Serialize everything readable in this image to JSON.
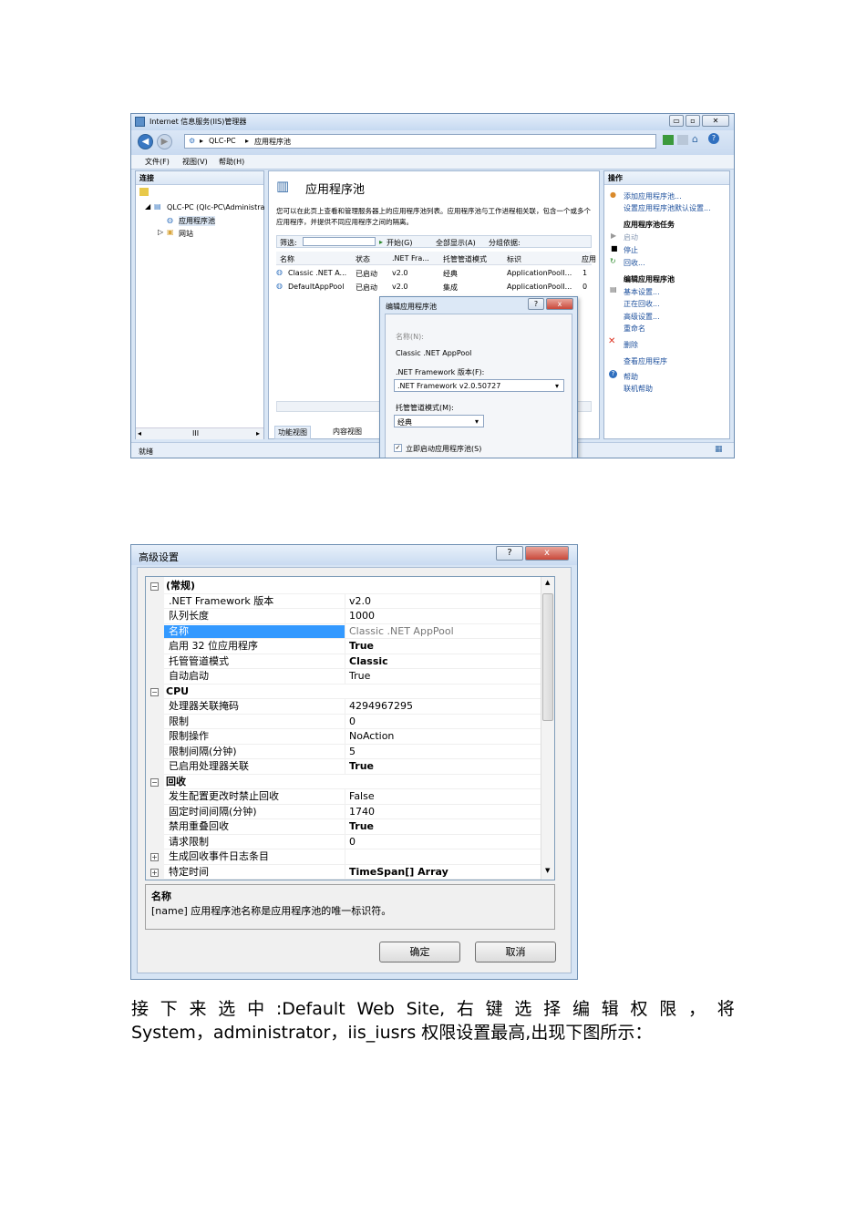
{
  "iis": {
    "title": "Internet 信息服务(IIS)管理器",
    "breadcrumb": [
      "QLC-PC",
      "应用程序池"
    ],
    "menu": [
      "文件(F)",
      "视图(V)",
      "帮助(H)"
    ],
    "connections": {
      "header": "连接",
      "tree": [
        "QLC-PC (Qlc-PC\\Administra",
        "应用程序池",
        "网站"
      ]
    },
    "main": {
      "title": "应用程序池",
      "description": "您可以在此页上查看和管理服务器上的应用程序池列表。应用程序池与工作进程相关联，包含一个或多个应用程序，并提供不同应用程序之间的隔离。",
      "filter_label": "筛选:",
      "start_label": "开始(G)",
      "show_all_label": "全部显示(A)",
      "group_label": "分组依据:",
      "columns": [
        "名称",
        "状态",
        ".NET Fra...",
        "托管管道模式",
        "标识",
        "应用"
      ],
      "rows": [
        [
          "Classic .NET A...",
          "已启动",
          "v2.0",
          "经典",
          "ApplicationPoolI...",
          "1"
        ],
        [
          "DefaultAppPool",
          "已启动",
          "v2.0",
          "集成",
          "ApplicationPoolI...",
          "0"
        ]
      ],
      "tabs": [
        "功能视图",
        "内容视图"
      ]
    },
    "actions": {
      "header": "操作",
      "items": [
        "添加应用程序池...",
        "设置应用程序池默认设置..."
      ],
      "tasks_header": "应用程序池任务",
      "tasks": [
        "启动",
        "停止",
        "回收..."
      ],
      "edit_header": "编辑应用程序池",
      "edit_items": [
        "基本设置...",
        "正在回收...",
        "高级设置...",
        "重命名"
      ],
      "delete": "删除",
      "view_apps": "查看应用程序",
      "help": "帮助",
      "online_help": "联机帮助"
    },
    "status": "就绪",
    "scroll_glyph": "III",
    "dialog": {
      "title": "编辑应用程序池",
      "name_label": "名称(N):",
      "name_value": "Classic .NET AppPool",
      "framework_label": ".NET Framework 版本(F):",
      "framework_value": ".NET Framework v2.0.50727",
      "pipeline_label": "托管管道模式(M):",
      "pipeline_value": "经典",
      "autostart_label": "立即启动应用程序池(S)",
      "close": "x",
      "help": "?"
    }
  },
  "advanced": {
    "title": "高级设置",
    "rows": [
      {
        "type": "cat",
        "key": "(常规)",
        "expander": "-"
      },
      {
        "key": ".NET Framework 版本",
        "value": "v2.0"
      },
      {
        "key": "队列长度",
        "value": "1000"
      },
      {
        "key": "名称",
        "value": "Classic .NET AppPool",
        "selected": true,
        "dim": true
      },
      {
        "key": "启用 32 位应用程序",
        "value": "True",
        "bold": true
      },
      {
        "key": "托管管道模式",
        "value": "Classic",
        "bold": true
      },
      {
        "key": "自动启动",
        "value": "True"
      },
      {
        "type": "cat",
        "key": "CPU",
        "expander": "-"
      },
      {
        "key": "处理器关联掩码",
        "value": "4294967295"
      },
      {
        "key": "限制",
        "value": "0"
      },
      {
        "key": "限制操作",
        "value": "NoAction"
      },
      {
        "key": "限制间隔(分钟)",
        "value": "5"
      },
      {
        "key": "已启用处理器关联",
        "value": "True",
        "bold": true
      },
      {
        "type": "cat",
        "key": "回收",
        "expander": "-"
      },
      {
        "key": "发生配置更改时禁止回收",
        "value": "False"
      },
      {
        "key": "固定时间间隔(分钟)",
        "value": "1740"
      },
      {
        "key": "禁用重叠回收",
        "value": "True",
        "bold": true
      },
      {
        "key": "请求限制",
        "value": "0"
      },
      {
        "key": "生成回收事件日志条目",
        "value": "",
        "expander": "+"
      },
      {
        "key": "特定时间",
        "value": "TimeSpan[] Array",
        "bold": true,
        "expander": "+"
      }
    ],
    "desc_title": "名称",
    "desc_text": "[name] 应用程序池名称是应用程序池的唯一标识符。",
    "ok": "确定",
    "cancel": "取消",
    "help": "?",
    "close": "x"
  },
  "paragraph": {
    "line1": [
      "接",
      "下",
      "来",
      "选",
      "中",
      ":Default",
      "Web",
      "Site,",
      "右",
      "键",
      "选",
      "择",
      "编",
      "辑",
      "权",
      "限",
      "，",
      "将"
    ],
    "line2": "System，administrator，iis_iusrs 权限设置最高,出现下图所示："
  }
}
